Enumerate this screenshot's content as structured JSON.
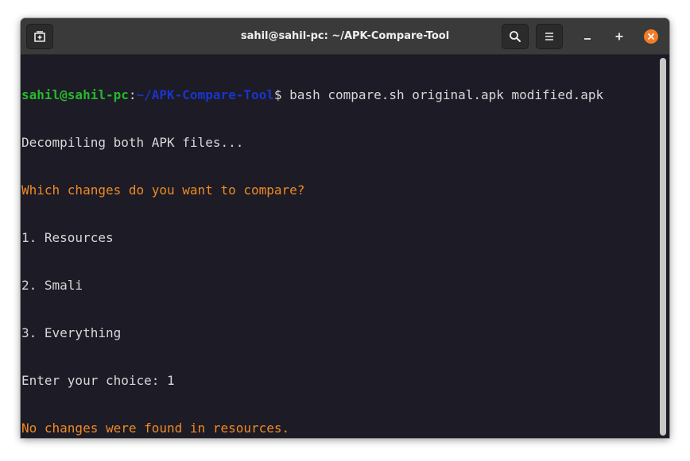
{
  "window": {
    "title": "sahil@sahil-pc: ~/APK-Compare-Tool"
  },
  "toolbar": {
    "new_tab_icon": "new-tab-icon",
    "search_icon": "search-icon",
    "menu_icon": "hamburger-menu-icon",
    "minimize_icon": "minimize-icon",
    "maximize_icon": "maximize-icon",
    "close_icon": "close-icon"
  },
  "colors": {
    "terminal_bg": "#1c1b26",
    "prompt_user": "#26b82b",
    "prompt_path": "#1a35c8",
    "warning_text": "#f08a24",
    "close_button": "#f57c26"
  },
  "terminal": {
    "prompt_user": "sahil@sahil-pc",
    "prompt_sep": ":",
    "prompt_path": "~/APK-Compare-Tool",
    "prompt_symbol": "$",
    "command": " bash compare.sh original.apk modified.apk",
    "output": [
      "Decompiling both APK files...",
      "Which changes do you want to compare?",
      "1. Resources",
      "2. Smali",
      "3. Everything",
      "Enter your choice: 1",
      "No changes were found in resources."
    ]
  }
}
